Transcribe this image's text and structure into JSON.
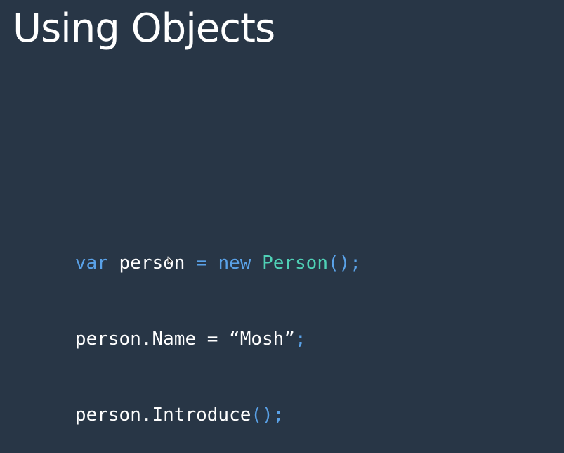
{
  "slide": {
    "title": "Using Objects",
    "background_color": "#283646"
  },
  "code": {
    "colors": {
      "default": "#ffffff",
      "keyword": "#5aa2e8",
      "type": "#4fd1b6",
      "punctuation": "#5aa2e8"
    },
    "lines": [
      {
        "tokens": [
          {
            "text": "var",
            "kind": "keyword"
          },
          {
            "text": " person ",
            "kind": "default"
          },
          {
            "text": "=",
            "kind": "punctuation"
          },
          {
            "text": " ",
            "kind": "default"
          },
          {
            "text": "new",
            "kind": "keyword"
          },
          {
            "text": " ",
            "kind": "default"
          },
          {
            "text": "Person",
            "kind": "type"
          },
          {
            "text": "();",
            "kind": "punctuation"
          }
        ]
      },
      {
        "tokens": [
          {
            "text": "person.Name = “Mosh”",
            "kind": "default"
          },
          {
            "text": ";",
            "kind": "punctuation"
          }
        ]
      },
      {
        "tokens": [
          {
            "text": "person.Introduce",
            "kind": "default"
          },
          {
            "text": "();",
            "kind": "punctuation"
          }
        ]
      }
    ]
  },
  "mouse_pointer": {
    "icon": "mouse-pointer-icon"
  }
}
